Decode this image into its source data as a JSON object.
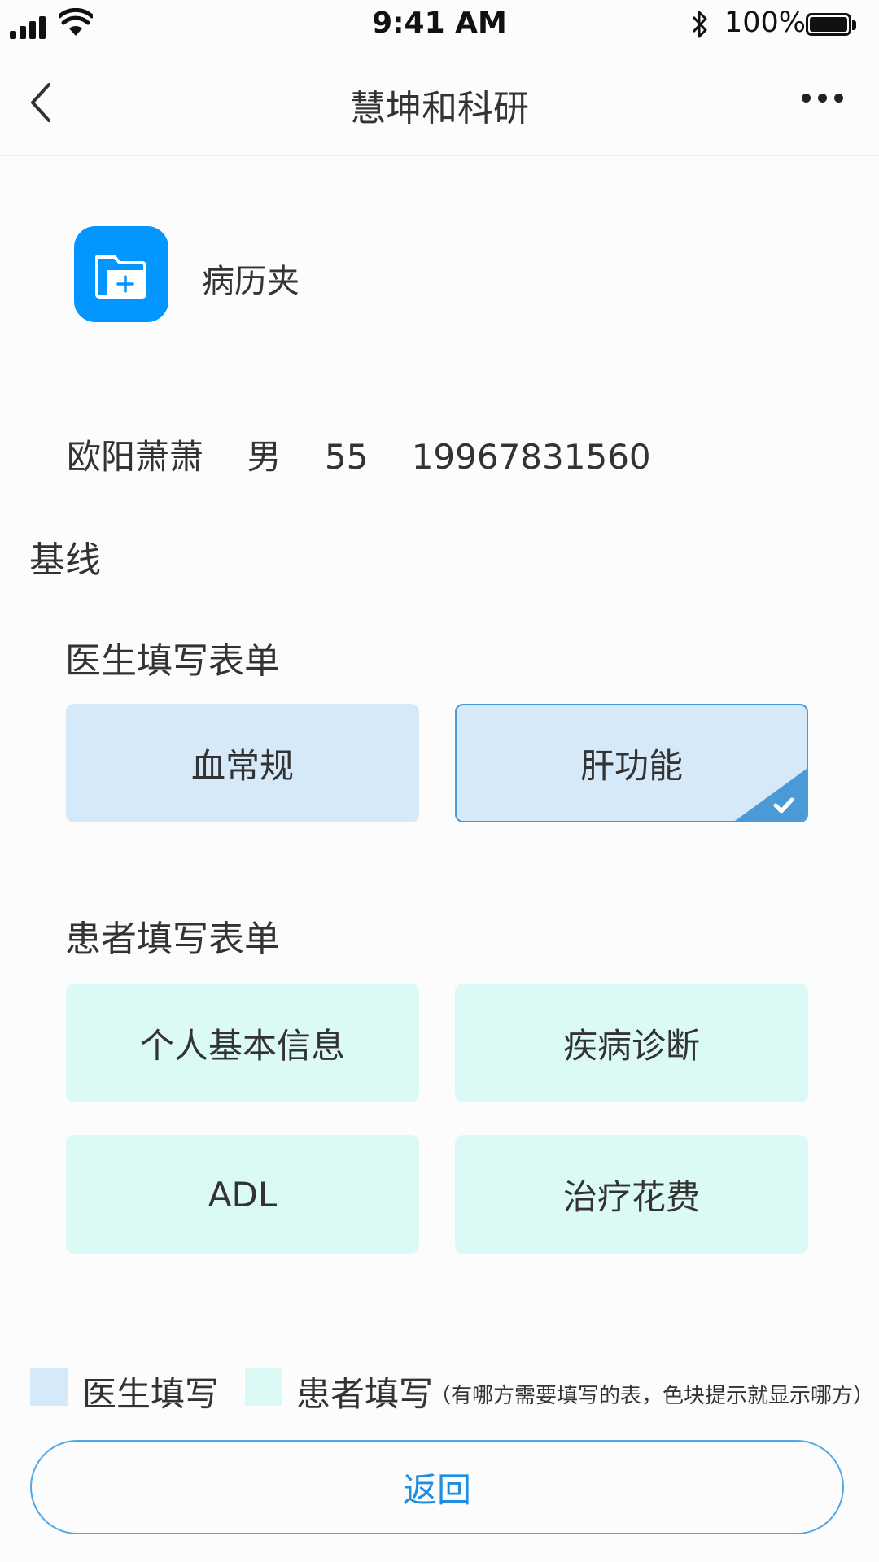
{
  "status_bar": {
    "time": "9:41 AM",
    "battery_percent": "100%",
    "icons": [
      "signal-icon",
      "wifi-icon",
      "bluetooth-icon",
      "battery-icon"
    ]
  },
  "nav": {
    "title": "慧坤和科研",
    "back_icon": "chevron-left-icon",
    "more_icon": "more-horizontal-icon"
  },
  "folder": {
    "label": "病历夹",
    "icon": "folder-add-icon",
    "color": "#0496ff"
  },
  "patient": {
    "name": "欧阳萧萧",
    "gender": "男",
    "age": "55",
    "phone": "19967831560"
  },
  "section": {
    "title": "基线"
  },
  "doctor_forms": {
    "title": "医生填写表单",
    "items": [
      {
        "label": "血常规",
        "selected": false
      },
      {
        "label": "肝功能",
        "selected": true
      }
    ]
  },
  "patient_forms": {
    "title": "患者填写表单",
    "items": [
      {
        "label": "个人基本信息"
      },
      {
        "label": "疾病诊断"
      },
      {
        "label": "ADL"
      },
      {
        "label": "治疗花费"
      }
    ]
  },
  "legend": {
    "doctor_label": "医生填写",
    "patient_label": "患者填写",
    "note": "（有哪方需要填写的表，色块提示就显示哪方）",
    "doctor_color": "#d6e9f9",
    "patient_color": "#dcfaf5"
  },
  "footer": {
    "return_label": "返回"
  },
  "colors": {
    "accent": "#1e8fe0",
    "selected_border": "#4a9ad8"
  }
}
